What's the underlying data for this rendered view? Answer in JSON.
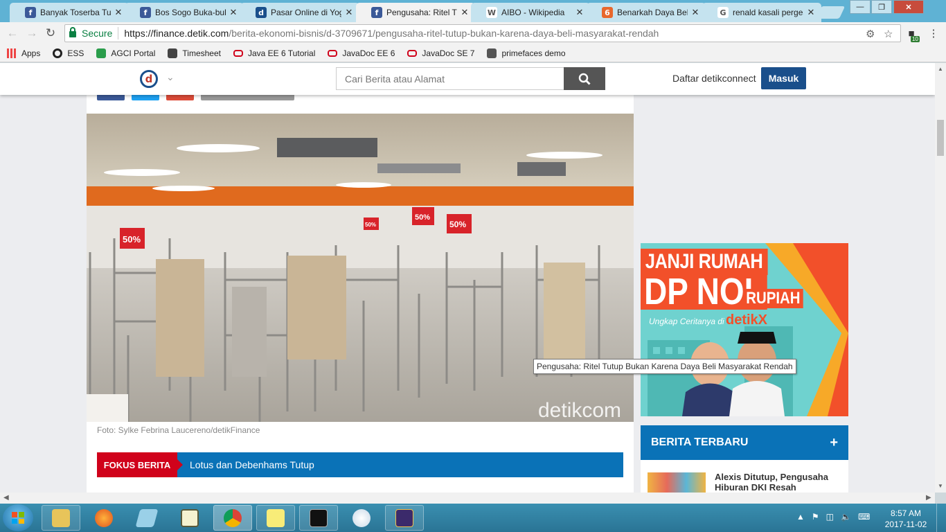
{
  "browser": {
    "tabs": [
      {
        "title": "Banyak Toserba Tutup",
        "icon": "facebook-icon",
        "color": "#3b5998",
        "glyph": "f"
      },
      {
        "title": "Bos Sogo Buka-bukaan",
        "icon": "facebook-icon",
        "color": "#3b5998",
        "glyph": "f"
      },
      {
        "title": "Pasar Online di Yogya",
        "icon": "detik-icon",
        "color": "#1a4f8b",
        "glyph": "d"
      },
      {
        "title": "Pengusaha: Ritel Tutup",
        "icon": "facebook-icon",
        "color": "#3b5998",
        "glyph": "f",
        "active": true
      },
      {
        "title": "AIBO - Wikipedia",
        "icon": "wikipedia-icon",
        "color": "#ffffff",
        "glyph": "W"
      },
      {
        "title": "Benarkah Daya Beli",
        "icon": "site-icon",
        "color": "#e8672c",
        "glyph": "6"
      },
      {
        "title": "renald kasali pergeseran",
        "icon": "google-icon",
        "color": "#ffffff",
        "glyph": "G"
      }
    ],
    "secure_label": "Secure",
    "url_host": "https://finance.detik.com",
    "url_path": "/berita-ekonomi-bisnis/d-3709671/pengusaha-ritel-tutup-bukan-karena-daya-beli-masyarakat-rendah",
    "extension_badge": "10",
    "bookmarks": [
      {
        "label": "Apps",
        "icon": "apps-grid-icon"
      },
      {
        "label": "ESS",
        "icon": "circle-icon"
      },
      {
        "label": "AGCI Portal",
        "icon": "globe-icon"
      },
      {
        "label": "Timesheet",
        "icon": "calendar-icon"
      },
      {
        "label": "Java EE 6 Tutorial",
        "icon": "oracle-icon"
      },
      {
        "label": "JavaDoc EE 6",
        "icon": "oracle-icon"
      },
      {
        "label": "JavaDoc SE 7",
        "icon": "oracle-icon"
      },
      {
        "label": "primefaces demo",
        "icon": "primefaces-icon"
      }
    ]
  },
  "site": {
    "logo_glyph": "d",
    "search_placeholder": "Cari Berita atau Alamat",
    "register_label": "Daftar detikconnect",
    "login_label": "Masuk"
  },
  "article": {
    "photo_watermark": "detikcom",
    "caption": "Foto: Sylke Febrina Laucereno/detikFinance",
    "fokus_label": "FOKUS BERITA",
    "fokus_value": "Lotus dan Debenhams Tutup",
    "price_tags": [
      "50%",
      "50%",
      "50%",
      "50%"
    ]
  },
  "ad": {
    "line1": "JANJI RUMAH",
    "line2": "DP NOL",
    "line3": "RUPIAH",
    "line4": "Ungkap Ceritanya di",
    "line5": "detikX"
  },
  "sidebar": {
    "section_title": "BERITA TERBARU",
    "expand_symbol": "+",
    "news": [
      {
        "title": "Alexis Ditutup, Pengusaha Hiburan DKI Resah"
      }
    ]
  },
  "tooltip": "Pengusaha: Ritel Tutup Bukan Karena Daya Beli Masyarakat Rendah",
  "taskbar": {
    "time": "8:57 AM",
    "date": "2017-11-02"
  },
  "colors": {
    "detik_blue": "#1a4f8b",
    "fokus_red": "#d0021b",
    "section_blue": "#0a72b7",
    "ad_orange": "#f2502a",
    "ad_teal": "#6fd2cf"
  }
}
